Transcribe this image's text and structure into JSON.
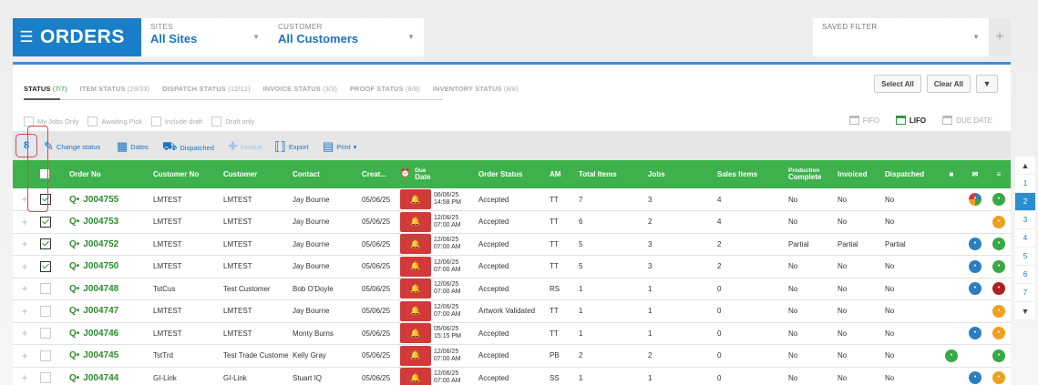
{
  "header": {
    "title": "ORDERS",
    "sites_label": "SITES",
    "sites_value": "All Sites",
    "customer_label": "CUSTOMER",
    "customer_value": "All Customers",
    "saved_filter_label": "SAVED FILTER"
  },
  "tabs": [
    {
      "label": "STATUS",
      "count": "(7/7)"
    },
    {
      "label": "ITEM STATUS",
      "count": "(29/33)"
    },
    {
      "label": "DISPATCH STATUS",
      "count": "(12/12)"
    },
    {
      "label": "INVOICE STATUS",
      "count": "(3/3)"
    },
    {
      "label": "PROOF STATUS",
      "count": "(8/8)"
    },
    {
      "label": "INVENTORY STATUS",
      "count": "(8/8)"
    }
  ],
  "actions": {
    "select_all": "Select All",
    "clear_all": "Clear All"
  },
  "filters": [
    "My Jobs Only",
    "Awaiting Pick",
    "Include draft",
    "Draft only"
  ],
  "sorting": {
    "fifo": "FIFO",
    "lifo": "LIFO",
    "due_date": "DUE DATE"
  },
  "toolbar": {
    "selected_count": "8",
    "change_status": "Change status",
    "dates": "Dates",
    "dispatched": "Dispatched",
    "invoice": "Invoice",
    "export": "Export",
    "print": "Print"
  },
  "columns": {
    "order_no": "Order No",
    "customer_no": "Customer No",
    "customer": "Customer",
    "contact": "Contact",
    "created": "Creat...",
    "due_top": "Due",
    "due": "Date",
    "order_status": "Order Status",
    "am": "AM",
    "total_items": "Total Items",
    "jobs": "Jobs",
    "sales_items": "Sales Items",
    "production_top": "Production",
    "production": "Complete",
    "invoiced": "Invoiced",
    "dispatched": "Dispatched"
  },
  "rows": [
    {
      "checked": true,
      "order": "J004755",
      "custno": "LMTEST",
      "customer": "LMTEST",
      "contact": "Jay Bourne",
      "created": "05/06/25",
      "due_date": "06/06/25",
      "due_time": "14:58 PM",
      "status": "Accepted",
      "am": "TT",
      "total": "7",
      "jobs": "3",
      "sales": "4",
      "prod": "No",
      "invoiced": "No",
      "dispatched": "No",
      "icons": [
        "",
        "multi",
        "green"
      ]
    },
    {
      "checked": true,
      "order": "J004753",
      "custno": "LMTEST",
      "customer": "LMTEST",
      "contact": "Jay Bourne",
      "created": "05/06/25",
      "due_date": "12/06/25",
      "due_time": "07:00 AM",
      "status": "Accepted",
      "am": "TT",
      "total": "6",
      "jobs": "2",
      "sales": "4",
      "prod": "No",
      "invoiced": "No",
      "dispatched": "No",
      "icons": [
        "",
        "",
        "orange"
      ]
    },
    {
      "checked": true,
      "order": "J004752",
      "custno": "LMTEST",
      "customer": "LMTEST",
      "contact": "Jay Bourne",
      "created": "05/06/25",
      "due_date": "12/06/25",
      "due_time": "07:00 AM",
      "status": "Accepted",
      "am": "TT",
      "total": "5",
      "jobs": "3",
      "sales": "2",
      "prod": "Partial",
      "invoiced": "Partial",
      "dispatched": "Partial",
      "icons": [
        "",
        "blue",
        "green"
      ]
    },
    {
      "checked": true,
      "order": "J004750",
      "custno": "LMTEST",
      "customer": "LMTEST",
      "contact": "Jay Bourne",
      "created": "05/06/25",
      "due_date": "12/06/25",
      "due_time": "07:00 AM",
      "status": "Accepted",
      "am": "TT",
      "total": "5",
      "jobs": "3",
      "sales": "2",
      "prod": "No",
      "invoiced": "No",
      "dispatched": "No",
      "icons": [
        "",
        "blue",
        "green"
      ]
    },
    {
      "checked": false,
      "order": "J004748",
      "custno": "TstCus",
      "customer": "Test Customer",
      "contact": "Bob O'Doyle",
      "created": "05/06/25",
      "due_date": "12/06/25",
      "due_time": "07:00 AM",
      "status": "Accepted",
      "am": "RS",
      "total": "1",
      "jobs": "1",
      "sales": "0",
      "prod": "No",
      "invoiced": "No",
      "dispatched": "No",
      "icons": [
        "",
        "blue",
        "red"
      ]
    },
    {
      "checked": false,
      "order": "J004747",
      "custno": "LMTEST",
      "customer": "LMTEST",
      "contact": "Jay Bourne",
      "created": "05/06/25",
      "due_date": "12/06/25",
      "due_time": "07:00 AM",
      "status": "Artwork Validated",
      "am": "TT",
      "total": "1",
      "jobs": "1",
      "sales": "0",
      "prod": "No",
      "invoiced": "No",
      "dispatched": "No",
      "icons": [
        "",
        "",
        "orange"
      ]
    },
    {
      "checked": false,
      "order": "J004746",
      "custno": "LMTEST",
      "customer": "LMTEST",
      "contact": "Monty Burns",
      "created": "05/06/25",
      "due_date": "05/06/25",
      "due_time": "15:15 PM",
      "status": "Accepted",
      "am": "TT",
      "total": "1",
      "jobs": "1",
      "sales": "0",
      "prod": "No",
      "invoiced": "No",
      "dispatched": "No",
      "icons": [
        "",
        "blue",
        "orange"
      ]
    },
    {
      "checked": false,
      "order": "J004745",
      "custno": "TstTrd",
      "customer": "Test Trade Customer",
      "contact": "Kelly Gray",
      "created": "05/06/25",
      "due_date": "12/06/25",
      "due_time": "07:00 AM",
      "status": "Accepted",
      "am": "PB",
      "total": "2",
      "jobs": "2",
      "sales": "0",
      "prod": "No",
      "invoiced": "No",
      "dispatched": "No",
      "icons": [
        "green",
        "",
        "green"
      ]
    },
    {
      "checked": false,
      "order": "J004744",
      "custno": "GI-Link",
      "customer": "GI-Link",
      "contact": "Stuart IQ",
      "created": "05/06/25",
      "due_date": "12/06/25",
      "due_time": "07:00 AM",
      "status": "Accepted",
      "am": "SS",
      "total": "1",
      "jobs": "1",
      "sales": "0",
      "prod": "No",
      "invoiced": "No",
      "dispatched": "No",
      "icons": [
        "",
        "blue",
        "orange"
      ]
    }
  ],
  "pager": [
    "1",
    "2",
    "3",
    "4",
    "5",
    "6",
    "7"
  ],
  "pager_active": "2",
  "colors": {
    "brand": "#1a7fc9",
    "header_green": "#3eb14c",
    "alert_red": "#d23a3a",
    "accent_link": "#1a73c4"
  }
}
